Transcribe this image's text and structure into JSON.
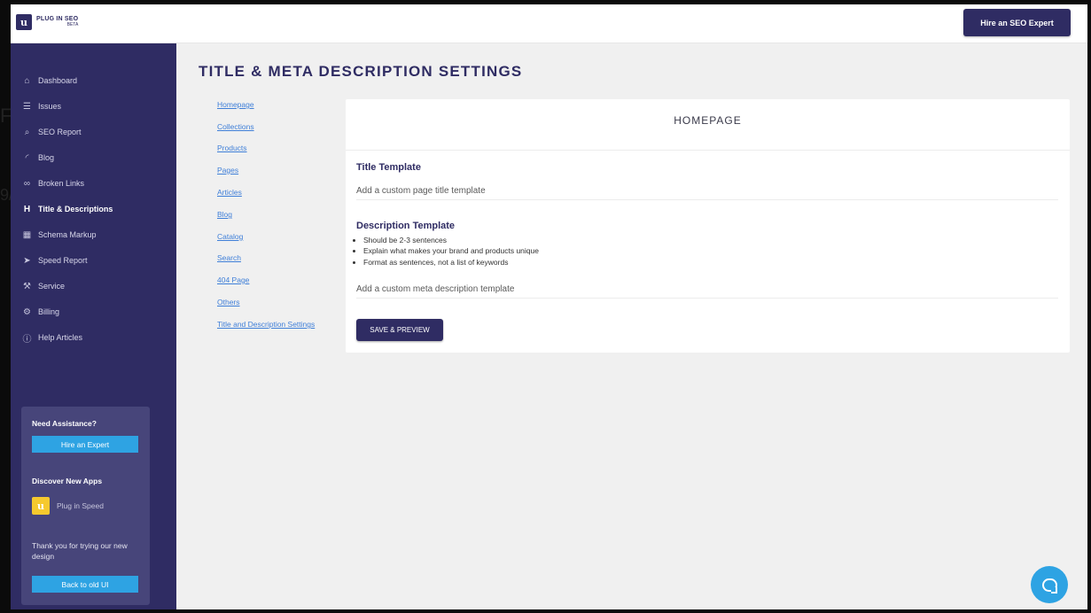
{
  "app": {
    "logo_mark": "u",
    "logo_name": "PLUG IN SEO",
    "logo_badge": "BETA",
    "hire_button": "Hire an SEO Expert"
  },
  "sidebar": {
    "items": [
      {
        "label": "Dashboard",
        "icon": "home-icon",
        "glyph": "⌂"
      },
      {
        "label": "Issues",
        "icon": "list-icon",
        "glyph": "☰"
      },
      {
        "label": "SEO Report",
        "icon": "search-report-icon",
        "glyph": "⌕"
      },
      {
        "label": "Blog",
        "icon": "rss-icon",
        "glyph": "◜"
      },
      {
        "label": "Broken Links",
        "icon": "link-icon",
        "glyph": "∞"
      },
      {
        "label": "Title & Descriptions",
        "icon": "heading-icon",
        "glyph": "H"
      },
      {
        "label": "Schema Markup",
        "icon": "table-icon",
        "glyph": "▦"
      },
      {
        "label": "Speed Report",
        "icon": "speed-icon",
        "glyph": "➤"
      },
      {
        "label": "Service",
        "icon": "wrench-icon",
        "glyph": "⚒"
      },
      {
        "label": "Billing",
        "icon": "gear-icon",
        "glyph": "⚙"
      },
      {
        "label": "Help Articles",
        "icon": "info-icon",
        "glyph": "ⓘ"
      }
    ],
    "active": "Title & Descriptions",
    "assist": {
      "heading": "Need Assistance?",
      "hire_button": "Hire an Expert",
      "discover_heading": "Discover New Apps",
      "app_mark": "u",
      "app_name": "Plug in Speed",
      "thanks": "Thank you for trying our new design",
      "back_button": "Back to old UI"
    }
  },
  "main": {
    "title": "TITLE & META DESCRIPTION SETTINGS",
    "sub_nav": [
      "Homepage",
      "Collections",
      "Products",
      "Pages",
      "Articles",
      "Blog",
      "Catalog",
      "Search",
      "404 Page",
      "Others",
      "Title and Description Settings"
    ],
    "card": {
      "heading": "HOMEPAGE",
      "title_label": "Title Template",
      "title_placeholder": "Add a custom page title template",
      "desc_label": "Description Template",
      "desc_tips": [
        "Should be 2-3 sentences",
        "Explain what makes your brand and products unique",
        "Format as sentences, not a list of keywords"
      ],
      "desc_placeholder": "Add a custom meta description template",
      "save_button": "SAVE & PREVIEW"
    }
  },
  "colors": {
    "brand": "#2f2c63",
    "accent": "#2ea3e3",
    "link": "#3f7fd8"
  }
}
